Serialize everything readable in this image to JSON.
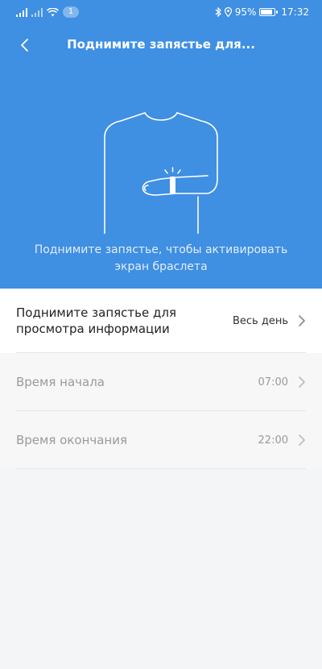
{
  "status_bar": {
    "badge": "1",
    "battery": "95%",
    "time": "17:32"
  },
  "header": {
    "title": "Поднимите запястье для..."
  },
  "hero": {
    "caption": "Поднимите запястье, чтобы активировать экран браслета"
  },
  "settings": {
    "rows": [
      {
        "label": "Поднимите запястье для просмотра информации",
        "value": "Весь день"
      },
      {
        "label": "Время начала",
        "value": "07:00"
      },
      {
        "label": "Время окончания",
        "value": "22:00"
      }
    ]
  },
  "colors": {
    "accent": "#3f8fe3",
    "background": "#f4f5f7"
  }
}
